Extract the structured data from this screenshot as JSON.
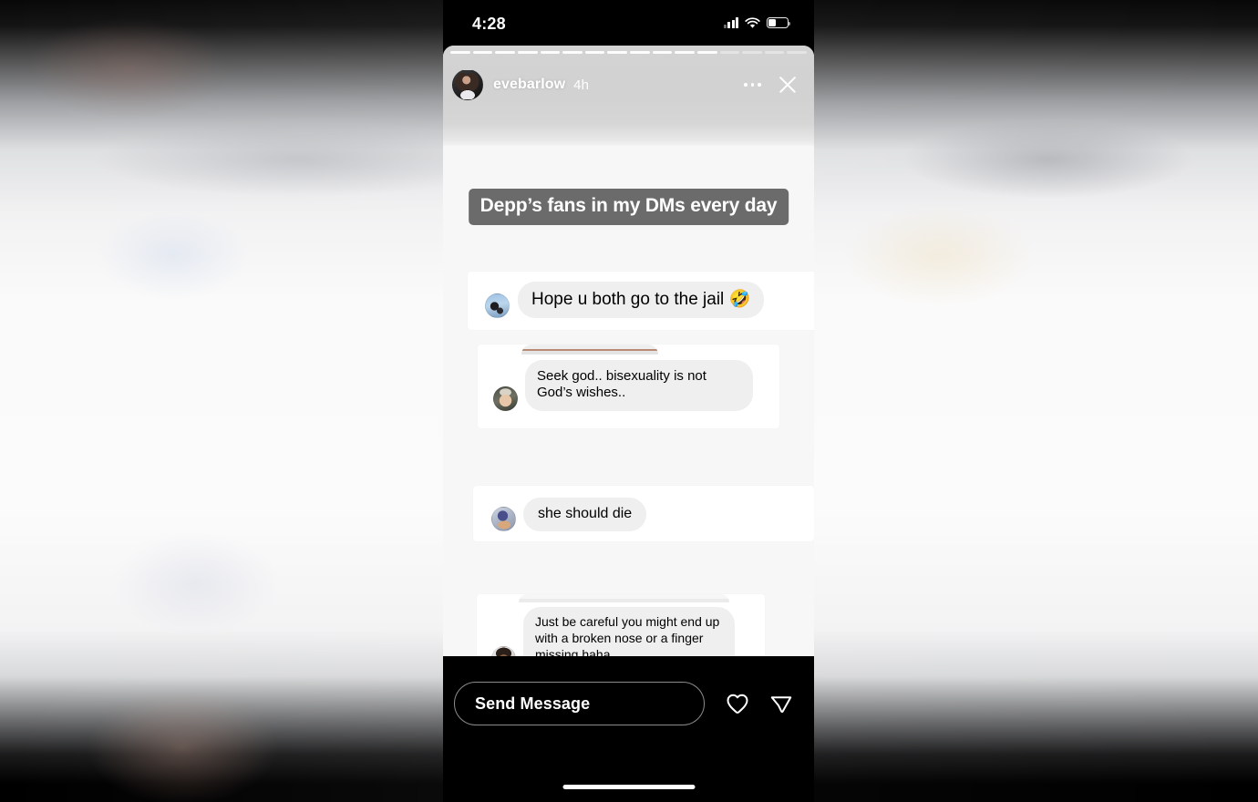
{
  "app": "Instagram Story Viewer",
  "status_bar": {
    "clock": "4:28",
    "signal_icon": "signal-bars-icon",
    "signal_bars_filled": 3,
    "wifi_icon": "wifi-icon",
    "battery_icon": "battery-icon",
    "battery_percent": 42
  },
  "story": {
    "progress": {
      "total_segments": 16,
      "viewed_segments": 12
    },
    "header": {
      "avatar_icon": "profile-avatar",
      "username": "evebarlow",
      "timestamp": "4h",
      "more_icon": "more-options-icon",
      "close_icon": "close-icon"
    },
    "sticker": {
      "text": "Depp’s fans in my DMs every day",
      "bg_color": "#6b6b6b",
      "text_color": "#ffffff"
    },
    "messages": [
      {
        "id": "msg-jail",
        "avatar_icon": "dm-sender-avatar-1",
        "text": "Hope u both go to the jail 🤣"
      },
      {
        "id": "msg-seek-god",
        "avatar_icon": "dm-sender-avatar-2",
        "text": "Seek god.. bisexuality is not God’s wishes.."
      },
      {
        "id": "msg-she-die",
        "avatar_icon": "dm-sender-avatar-3",
        "text": "she should die"
      },
      {
        "id": "msg-careful",
        "avatar_icon": "dm-sender-avatar-4",
        "text": "Just be careful you might end up with a broken nose or a finger missing haha"
      }
    ],
    "bubble_bg": "#efefef",
    "card_bg": "#ffffff",
    "canvas_bg": "#f7f7f7"
  },
  "reply_bar": {
    "placeholder": "Send Message",
    "heart_icon": "heart-icon",
    "share_icon": "share-paper-plane-icon"
  },
  "home_indicator": "home-indicator"
}
